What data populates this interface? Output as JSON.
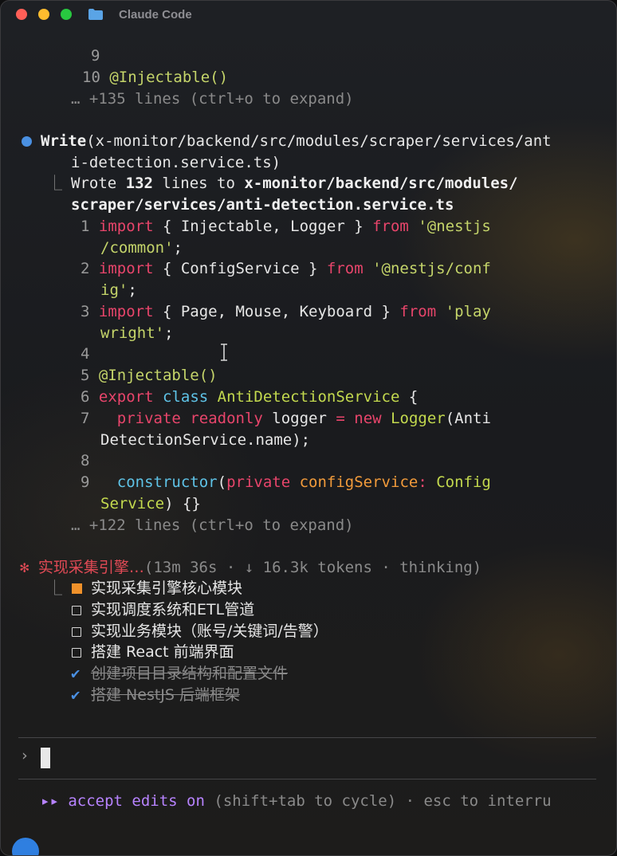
{
  "window": {
    "title": "Claude Code"
  },
  "first_block": {
    "line9_num": "9",
    "line10_num": "10",
    "line10_code": "@Injectable()",
    "more": "… +135 lines (ctrl+o to expand)"
  },
  "write_block": {
    "call_prefix": "Write",
    "call_line1": "(x-monitor/backend/src/modules/scraper/services/ant",
    "call_line2": "i-detection.service.ts)",
    "wrote_prefix": "Wrote ",
    "wrote_count": "132",
    "wrote_mid": " lines to ",
    "wrote_path1": "x-monitor/backend/src/modules/",
    "wrote_path2": "scraper/services/anti-detection.service.ts",
    "lines": {
      "n1": "1",
      "n2": "2",
      "n3": "3",
      "n4": "4",
      "n5": "5",
      "n6": "6",
      "n7": "7",
      "n8": "8",
      "n9": "9",
      "import": "import",
      "from": "from",
      "l1_body": " { Injectable, Logger } ",
      "l1_str_a": "'@nestjs",
      "l1_str_b": "/common'",
      "semi": ";",
      "l2_body": " { ConfigService } ",
      "l2_str_a": "'@nestjs/conf",
      "l2_str_b": "ig'",
      "l3_body": " { Page, Mouse, Keyboard } ",
      "l3_str_a": "'play",
      "l3_str_b": "wright'",
      "l5": "@Injectable()",
      "export": "export",
      "class": "class",
      "classname": "AntiDetectionService",
      "brace": " {",
      "private": "private",
      "readonly": "readonly",
      "logger": "logger",
      "eq": "=",
      "new": "new",
      "Logger": "Logger",
      "l7_a": "(Anti",
      "l7_b": "DetectionService.name);",
      "constructor": "constructor",
      "paren_open": "(",
      "configService": "configService",
      "colon": ":",
      "Config": "Config",
      "l9_b1": "Service",
      "l9_b2": ") {}"
    },
    "more": "… +122 lines (ctrl+o to expand)"
  },
  "status": {
    "task": "实现采集引擎…",
    "meta": "(13m 36s · ↓ 16.3k tokens · thinking)"
  },
  "todos": [
    {
      "text": "实现采集引擎核心模块",
      "state": "in-progress"
    },
    {
      "text": "实现调度系统和ETL管道",
      "state": "pending"
    },
    {
      "text": "实现业务模块（账号/关键词/告警）",
      "state": "pending"
    },
    {
      "text": "搭建 React 前端界面",
      "state": "pending"
    },
    {
      "text": "创建项目目录结构和配置文件",
      "state": "done"
    },
    {
      "text": "搭建 NestJS 后端框架",
      "state": "done"
    }
  ],
  "prompt": {
    "chevron": "›"
  },
  "footer": {
    "arrows": "▸▸",
    "mode": "accept edits on",
    "hint": " (shift+tab to cycle) · esc to interru"
  },
  "colors": {
    "keyword": "#e8456b",
    "string": "#c5d56a",
    "accent_blue": "#4a90e2",
    "accent_orange": "#f0912a",
    "mode_purple": "#b783ff"
  }
}
